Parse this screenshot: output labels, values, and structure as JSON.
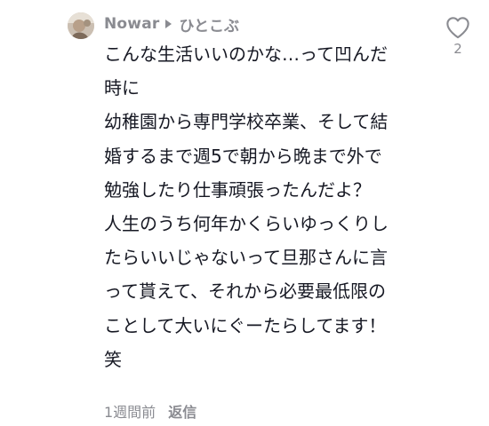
{
  "comment": {
    "username": "Nowar",
    "reply_to": "ひとこぶ",
    "body_lines": [
      "こんな生活いいのかな…って凹んだ",
      "時に",
      "幼稚園から専門学校卒業、そして結",
      "婚するまで週5で朝から晩まで外で",
      "勉強したり仕事頑張ったんだよ？",
      "人生のうち何年かくらいゆっくりし",
      "たらいいじゃないって旦那さんに言",
      "って貰えて、それから必要最低限の",
      "ことして大いにぐーたらしてます！",
      "笑"
    ],
    "timestamp": "1週間前",
    "reply_label": "返信",
    "like_count": "2",
    "icons": {
      "reply_arrow": "caret-right-icon",
      "like": "heart-outline-icon"
    },
    "colors": {
      "text": "#161823",
      "muted": "#8a8b91"
    }
  }
}
